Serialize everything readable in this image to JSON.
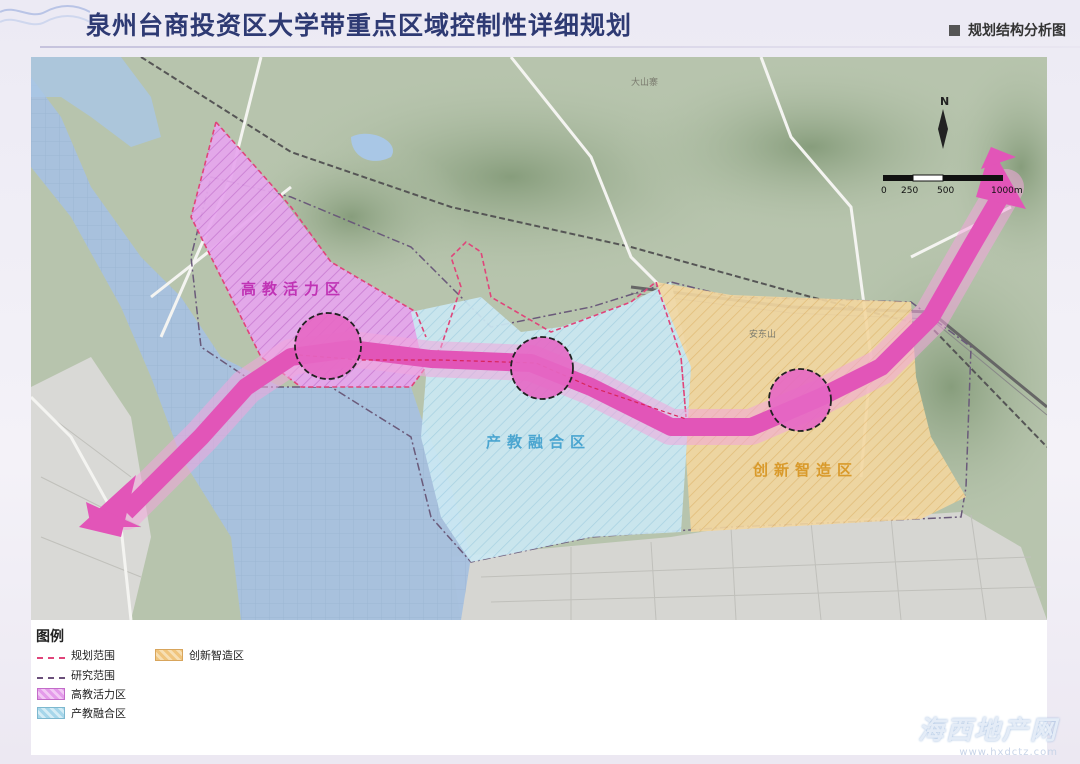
{
  "header": {
    "title": "泉州台商投资区大学带重点区域控制性详细规划",
    "subtitle": "规划结构分析图"
  },
  "map": {
    "zones": {
      "higher_ed": "高教活力区",
      "industry_edu": "产教融合区",
      "innovation": "创新智造区"
    },
    "north_label": "N",
    "scale": {
      "ticks": [
        "0",
        "250",
        "500",
        "1000m"
      ]
    },
    "place_labels": {
      "mountain": "安东山",
      "mountain2": "大山寨"
    },
    "colors": {
      "axis": "#e255b8",
      "higher_ed": "#dd8ee6",
      "industry_edu": "#bfe3f0",
      "innovation": "#f2cf8f",
      "water": "#a9c7e6",
      "plan_boundary": "#e0447a"
    }
  },
  "legend": {
    "title": "图例",
    "items": [
      {
        "label": "规划范围",
        "icon": "dashed-pink-line"
      },
      {
        "label": "研究范围",
        "icon": "dash-dot-line"
      },
      {
        "label": "高教活力区",
        "icon": "pink-hatch"
      },
      {
        "label": "产教融合区",
        "icon": "blue-hatch"
      },
      {
        "label": "创新智造区",
        "icon": "orange-hatch"
      }
    ]
  },
  "watermark": {
    "main": "海西地产网",
    "url": "www.hxdctz.com"
  }
}
